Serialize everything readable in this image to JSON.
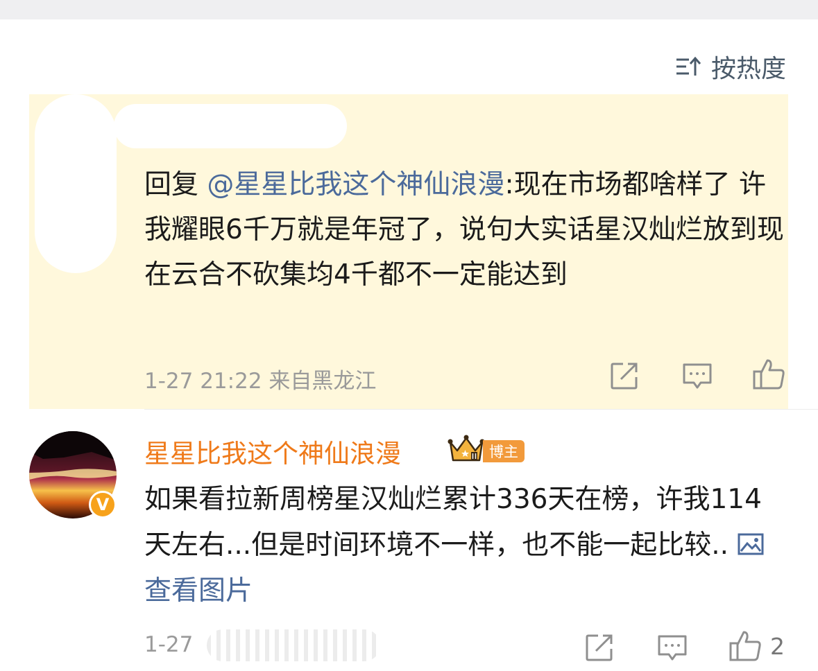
{
  "sort": {
    "label": "按热度",
    "icon": "sort-icon"
  },
  "comment1": {
    "reply_prefix": "回复",
    "mention": "@星星比我这个神仙浪漫",
    "body": ":现在市场都啥样了 许我耀眼6千万就是年冠了，说句大实话星汉灿烂放到现在云合不砍集均4千都不一定能达到",
    "date": "1-27 21:22",
    "location": "来自黑龙江",
    "icons": [
      "share-icon",
      "comment-icon",
      "like-icon"
    ],
    "background": "#fff8dc"
  },
  "comment2": {
    "username": "星星比我这个神仙浪漫",
    "author_badge": "博主",
    "verified_mark": "V",
    "body": "如果看拉新周榜星汉灿烂累计336天在榜，许我114天左右...但是时间环境不一样，也不能一起比较..",
    "image_link": "查看图片",
    "date": "1-27",
    "like_count": "2",
    "icons": [
      "share-icon",
      "comment-icon",
      "like-icon",
      "image-icon",
      "crown-icon"
    ],
    "username_color": "#ef7a1a"
  }
}
